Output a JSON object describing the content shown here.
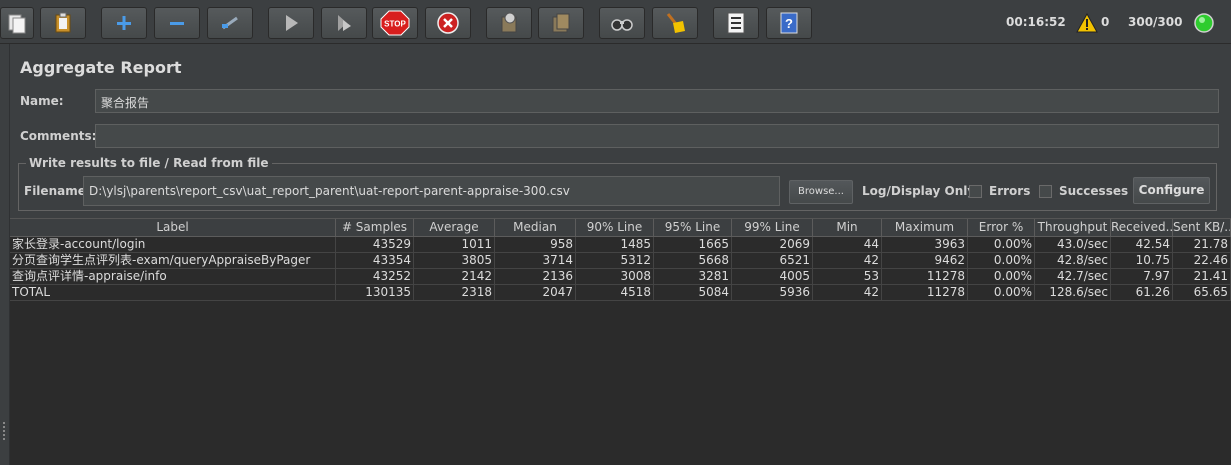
{
  "toolbar": {
    "buttons": [
      {
        "name": "templates-icon"
      },
      {
        "name": "clipboard-icon"
      },
      {
        "name": "expand-all-icon"
      },
      {
        "name": "collapse-all-icon"
      },
      {
        "name": "toggle-icon"
      },
      {
        "name": "start-icon"
      },
      {
        "name": "start-no-pauses-icon"
      },
      {
        "name": "stop-icon"
      },
      {
        "name": "shutdown-icon"
      },
      {
        "name": "clear-icon"
      },
      {
        "name": "clear-all-icon"
      },
      {
        "name": "search-icon"
      },
      {
        "name": "reset-search-icon"
      },
      {
        "name": "function-helper-icon"
      },
      {
        "name": "help-icon"
      }
    ],
    "stop_label": "STOP",
    "elapsed_time": "00:16:52",
    "warning_count": "0",
    "threads": "300/300",
    "colors": {
      "status_indicator": "#2ecc2e",
      "warning": "#f2c200",
      "stop": "#d81e1e",
      "shutdown": "#cc2222",
      "add": "#4a9be8"
    }
  },
  "panel": {
    "title": "Aggregate Report",
    "name_label": "Name:",
    "name_value": "聚合报告",
    "comments_label": "Comments:",
    "comments_value": "",
    "file_section_legend": "Write results to file / Read from file",
    "filename_label": "Filename",
    "filename_value": "D:\\ylsj\\parents\\report_csv\\uat_report_parent\\uat-report-parent-appraise-300.csv",
    "browse_label": "Browse...",
    "log_display_label": "Log/Display Only:",
    "errors_label": "Errors",
    "successes_label": "Successes",
    "configure_label": "Configure"
  },
  "table": {
    "columns": [
      "Label",
      "# Samples",
      "Average",
      "Median",
      "90% Line",
      "95% Line",
      "99% Line",
      "Min",
      "Maximum",
      "Error %",
      "Throughput",
      "Received...",
      "Sent KB/..."
    ],
    "rows": [
      [
        "家长登录-account/login",
        "43529",
        "1011",
        "958",
        "1485",
        "1665",
        "2069",
        "44",
        "3963",
        "0.00%",
        "43.0/sec",
        "42.54",
        "21.78"
      ],
      [
        "分页查询学生点评列表-exam/queryAppraiseByPager",
        "43354",
        "3805",
        "3714",
        "5312",
        "5668",
        "6521",
        "42",
        "9462",
        "0.00%",
        "42.8/sec",
        "10.75",
        "22.46"
      ],
      [
        "查询点评详情-appraise/info",
        "43252",
        "2142",
        "2136",
        "3008",
        "3281",
        "4005",
        "53",
        "11278",
        "0.00%",
        "42.7/sec",
        "7.97",
        "21.41"
      ],
      [
        "TOTAL",
        "130135",
        "2318",
        "2047",
        "4518",
        "5084",
        "5936",
        "42",
        "11278",
        "0.00%",
        "128.6/sec",
        "61.26",
        "65.65"
      ]
    ]
  }
}
